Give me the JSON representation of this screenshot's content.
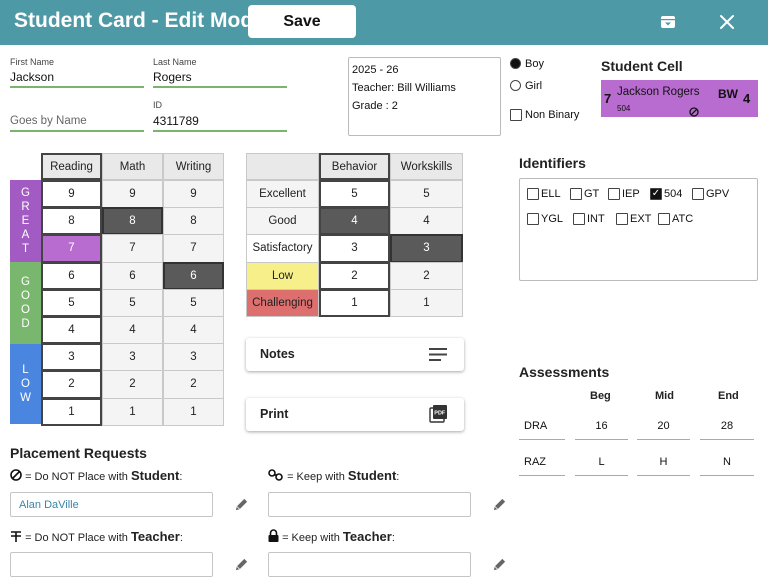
{
  "header": {
    "title": "Student Card - Edit Mode",
    "save_label": "Save",
    "background_color": "#4e99a6"
  },
  "fields": {
    "first_name": {
      "label": "First Name",
      "value": "Jackson"
    },
    "last_name": {
      "label": "Last Name",
      "value": "Rogers"
    },
    "goes_by": {
      "placeholder": "Goes by Name",
      "value": ""
    },
    "id": {
      "label": "ID",
      "value": "4311789"
    }
  },
  "info": {
    "year": "2025 - 26",
    "teacher": "Teacher: Bill Williams",
    "grade": "Grade : 2"
  },
  "gender": {
    "options": [
      {
        "label": "Boy",
        "selected": true
      },
      {
        "label": "Girl",
        "selected": false
      }
    ],
    "non_binary": {
      "label": "Non Binary",
      "checked": false
    }
  },
  "student_cell": {
    "title": "Student Cell",
    "level_left": "7",
    "name": "Jackson Rogers",
    "teacher_initials": "BW",
    "level_right": "4",
    "tag": "504",
    "color": "#b86cd0"
  },
  "academics": {
    "columns": [
      "Reading",
      "Math",
      "Writing"
    ],
    "rows": [
      "9",
      "8",
      "7",
      "6",
      "5",
      "4",
      "3",
      "2",
      "1"
    ],
    "bands": [
      {
        "letters": [
          "G",
          "R",
          "E",
          "A",
          "T"
        ],
        "color": "#a35bc4"
      },
      {
        "letters": [
          "G",
          "O",
          "O",
          "D"
        ],
        "color": "#7ab76e"
      },
      {
        "letters": [
          "L",
          "O",
          "W"
        ],
        "color": "#4a86e0"
      }
    ],
    "selected": {
      "Reading": "7",
      "Math": "8",
      "Writing": "6"
    }
  },
  "behavior": {
    "columns": [
      "Behavior",
      "Workskills"
    ],
    "rows": [
      {
        "label": "Excellent",
        "values": [
          "5",
          "5"
        ]
      },
      {
        "label": "Good",
        "values": [
          "4",
          "4"
        ]
      },
      {
        "label": "Satisfactory",
        "values": [
          "3",
          "3"
        ]
      },
      {
        "label": "Low",
        "values": [
          "2",
          "2"
        ]
      },
      {
        "label": "Challenging",
        "values": [
          "1",
          "1"
        ]
      }
    ],
    "selected": {
      "Behavior": "4",
      "Workskills": "3"
    },
    "row_colors": {
      "Low": "#f7f08a",
      "Challenging": "#dd6f6f"
    }
  },
  "buttons": {
    "notes": "Notes",
    "print": "Print"
  },
  "identifiers": {
    "title": "Identifiers",
    "items": [
      {
        "label": "ELL",
        "checked": false
      },
      {
        "label": "GT",
        "checked": false
      },
      {
        "label": "IEP",
        "checked": false
      },
      {
        "label": "504",
        "checked": true
      },
      {
        "label": "GPV",
        "checked": false
      },
      {
        "label": "YGL",
        "checked": false
      },
      {
        "label": "INT",
        "checked": false
      },
      {
        "label": "EXT",
        "checked": false
      },
      {
        "label": "ATC",
        "checked": false
      }
    ]
  },
  "assessments": {
    "title": "Assessments",
    "columns": [
      "Beg",
      "Mid",
      "End"
    ],
    "rows": [
      {
        "name": "DRA",
        "values": [
          "16",
          "20",
          "28"
        ]
      },
      {
        "name": "RAZ",
        "values": [
          "L",
          "H",
          "N"
        ]
      }
    ]
  },
  "placement": {
    "title": "Placement Requests",
    "no_student": {
      "pre": "= Do NOT Place with ",
      "bold": "Student",
      "post": ":",
      "value": "Alan DaVille"
    },
    "keep_student": {
      "pre": "= Keep with ",
      "bold": "Student",
      "post": ":",
      "value": ""
    },
    "no_teacher": {
      "pre": "= Do NOT Place with ",
      "bold": "Teacher",
      "post": ":",
      "value": ""
    },
    "keep_teacher": {
      "pre": "= Keep with ",
      "bold": "Teacher",
      "post": ":",
      "value": ""
    }
  }
}
